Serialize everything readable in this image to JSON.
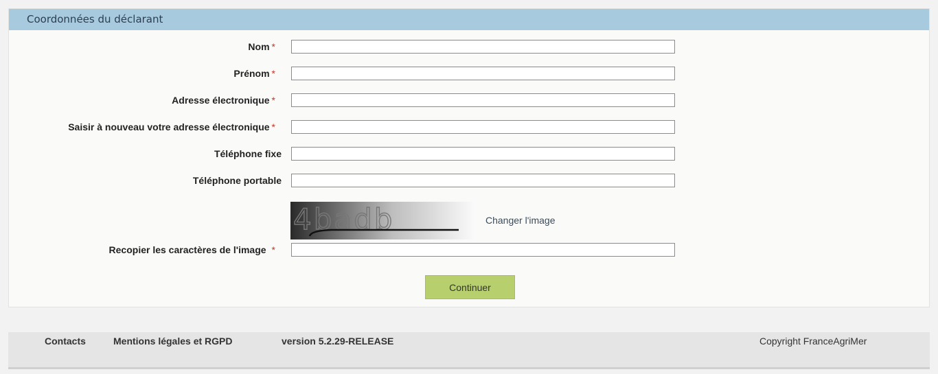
{
  "section": {
    "title": "Coordonnées du déclarant"
  },
  "form": {
    "required_mark": "*",
    "fields": [
      {
        "label": "Nom",
        "required": true,
        "value": ""
      },
      {
        "label": "Prénom",
        "required": true,
        "value": ""
      },
      {
        "label": "Adresse électronique",
        "required": true,
        "value": ""
      },
      {
        "label": "Saisir à nouveau votre adresse électronique",
        "required": true,
        "value": ""
      },
      {
        "label": "Téléphone fixe",
        "required": false,
        "value": ""
      },
      {
        "label": "Téléphone portable",
        "required": false,
        "value": ""
      }
    ],
    "captcha": {
      "text": "4badb",
      "change_link": "Changer l'image",
      "label": "Recopier les caractères de l'image",
      "value": ""
    },
    "submit_label": "Continuer"
  },
  "footer": {
    "contacts": "Contacts",
    "legal": "Mentions légales et RGPD",
    "version": "version 5.2.29-RELEASE",
    "copyright": "Copyright FranceAgriMer"
  },
  "colors": {
    "header_bg": "#a8cade",
    "button_bg": "#b8cf6e",
    "required": "#c0392b"
  }
}
